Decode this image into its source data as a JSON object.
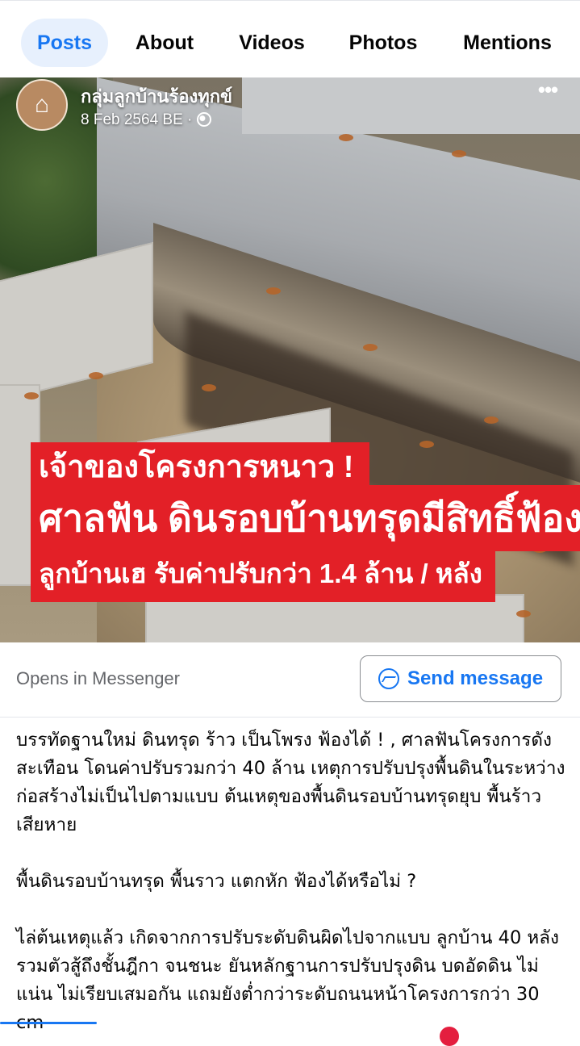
{
  "tabs": [
    {
      "label": "Posts"
    },
    {
      "label": "About"
    },
    {
      "label": "Videos"
    },
    {
      "label": "Photos"
    },
    {
      "label": "Mentions"
    }
  ],
  "post": {
    "page_name": "กลุ่มลูกบ้านร้องทุกข์",
    "date": "8 Feb 2564 BE ·",
    "more_icon": "more-horizontal-icon",
    "privacy_icon": "globe-icon"
  },
  "image_banner": {
    "line1": "เจ้าของโครงการหนาว !",
    "line2": "ศาลฟัน ดินรอบบ้านทรุดมีสิทธิ์ฟ้อง",
    "line3": "ลูกบ้านเฮ รับค่าปรับกว่า 1.4 ล้าน / หลัง",
    "color": "#e32027"
  },
  "cta": {
    "opens_text": "Opens in Messenger",
    "button_label": "Send message",
    "button_icon": "messenger-icon",
    "accent": "#1877f2"
  },
  "body": {
    "paragraphs": [
      "บรรทัดฐานใหม่ ดินทรุด ร้าว เป็นโพรง ฟ้องได้ ! , ศาลฟันโครงการดังสะเทือน โดนค่าปรับรวมกว่า 40 ล้าน เหตุการปรับปรุงพื้นดินในระหว่างก่อสร้างไม่เป็นไปตามแบบ ต้นเหตุของพื้นดินรอบบ้านทรุดยุบ พื้นร้าวเสียหาย",
      "พื้นดินรอบบ้านทรุด พื้นราว แตกหัก ฟ้องได้หรือไม่ ?",
      "ไล่ต้นเหตุแล้ว เกิดจากการปรับระดับดินผิดไปจากแบบ ลูกบ้าน 40 หลัง รวมตัวสู้ถึงชั้นฎีกา จนชนะ ยันหลักฐานการปรับปรุงดิน บดอัดดิน ไม่แน่น ไม่เรียบเสมอกัน แถมยังต่ำกว่าระดับถนนหน้าโครงการกว่า 30 cm"
    ]
  }
}
